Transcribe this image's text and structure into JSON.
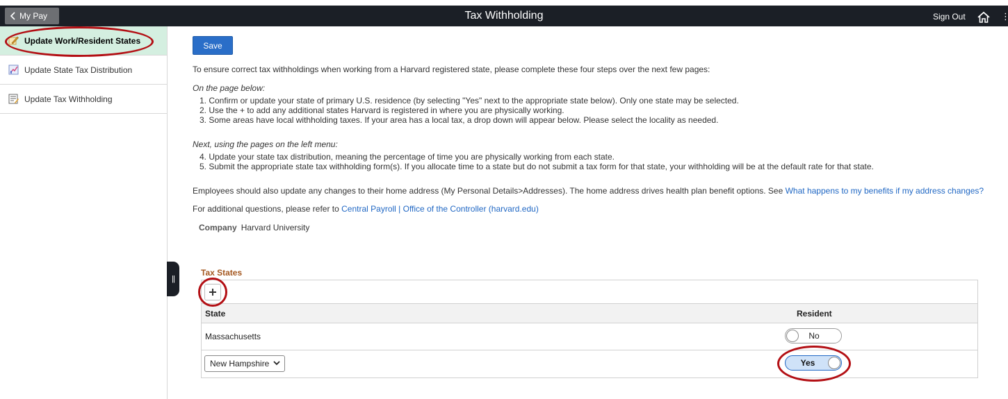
{
  "header": {
    "back_label": "My Pay",
    "title": "Tax Withholding",
    "signout_label": "Sign Out"
  },
  "sidebar": {
    "items": [
      {
        "label": "Update Work/Resident States",
        "active": true,
        "icon": "edit-pencil-icon"
      },
      {
        "label": "Update State Tax Distribution",
        "active": false,
        "icon": "chart-distribution-icon"
      },
      {
        "label": "Update Tax Withholding",
        "active": false,
        "icon": "form-document-icon"
      }
    ]
  },
  "main": {
    "save_label": "Save",
    "intro": "To ensure correct tax withholdings when working from a Harvard registered state, please complete these four steps over the next few pages:",
    "section1_heading": "On the page below:",
    "steps1": [
      "1. Confirm or update your state of primary U.S. residence (by selecting \"Yes\" next to the appropriate state below). Only one state may be selected.",
      "2. Use the + to add any additional states Harvard is registered in where you are physically working.",
      "3. Some areas have local withholding taxes. If your area has a local tax, a drop down will appear below. Please select the locality as needed."
    ],
    "section2_heading": "Next, using the pages on the left menu:",
    "steps2": [
      "4. Update your state tax distribution, meaning the percentage of time you are physically working from each state.",
      "5. Submit the appropriate state tax withholding form(s). If you allocate time to a state but do not submit a tax form for that state, your withholding will be at the default rate for that state."
    ],
    "address_note": "Employees should also update any changes to their home address (My Personal Details>Addresses). The home address drives health plan benefit options. See ",
    "address_link": "What happens to my benefits if my address changes?",
    "questions_note": "For additional questions, please refer to ",
    "questions_link": "Central Payroll | Office of the Controller (harvard.edu)",
    "company_label": "Company",
    "company_value": "Harvard University"
  },
  "tax_states": {
    "title": "Tax States",
    "columns": [
      "State",
      "Resident"
    ],
    "rows": [
      {
        "state": "Massachusetts",
        "resident": "No"
      },
      {
        "state": "New Hampshire",
        "resident": "Yes"
      }
    ]
  },
  "colors": {
    "header_bg": "#1b1f26",
    "active_sidebar": "#d4efe0",
    "save_button": "#2a6ec8",
    "link": "#2168c4",
    "grid_title": "#a4571f",
    "annotation_circle": "#b30f14"
  }
}
